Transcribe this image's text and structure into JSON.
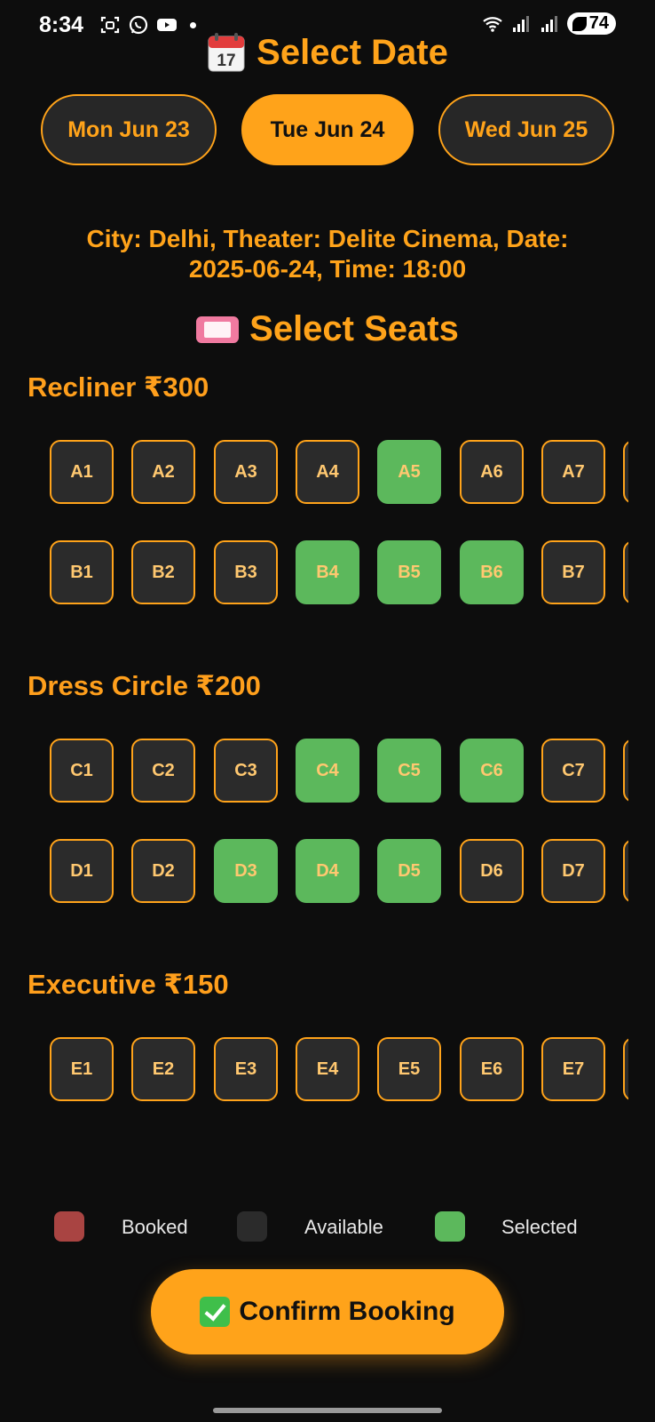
{
  "status_bar": {
    "time": "8:34",
    "battery": "74",
    "left_icons": [
      "scan-icon",
      "whatsapp-icon",
      "youtube-icon",
      "dot-icon"
    ],
    "right_icons": [
      "wifi-icon",
      "signal-icon",
      "signal-icon",
      "battery-icon"
    ]
  },
  "header": {
    "title": "Select Date",
    "icon": "calendar-icon"
  },
  "dates": [
    {
      "label": "Mon Jun 23",
      "selected": false
    },
    {
      "label": "Tue Jun 24",
      "selected": true
    },
    {
      "label": "Wed Jun 25",
      "selected": false
    }
  ],
  "info": {
    "line1": "City: Delhi, Theater: Delite Cinema, Date:",
    "line2": "2025-06-24, Time: 18:00"
  },
  "seats_header": {
    "title": "Select Seats",
    "icon": "ticket-icon"
  },
  "sections": [
    {
      "title": "Recliner ₹300",
      "rows": [
        {
          "seats": [
            {
              "label": "A1",
              "status": "available"
            },
            {
              "label": "A2",
              "status": "available"
            },
            {
              "label": "A3",
              "status": "available"
            },
            {
              "label": "A4",
              "status": "available"
            },
            {
              "label": "A5",
              "status": "selected"
            },
            {
              "label": "A6",
              "status": "available"
            },
            {
              "label": "A7",
              "status": "available"
            },
            {
              "label": "",
              "status": "available"
            }
          ]
        },
        {
          "seats": [
            {
              "label": "B1",
              "status": "available"
            },
            {
              "label": "B2",
              "status": "available"
            },
            {
              "label": "B3",
              "status": "available"
            },
            {
              "label": "B4",
              "status": "selected"
            },
            {
              "label": "B5",
              "status": "selected"
            },
            {
              "label": "B6",
              "status": "selected"
            },
            {
              "label": "B7",
              "status": "available"
            },
            {
              "label": "",
              "status": "available"
            }
          ]
        }
      ]
    },
    {
      "title": "Dress Circle ₹200",
      "rows": [
        {
          "seats": [
            {
              "label": "C1",
              "status": "available"
            },
            {
              "label": "C2",
              "status": "available"
            },
            {
              "label": "C3",
              "status": "available"
            },
            {
              "label": "C4",
              "status": "selected"
            },
            {
              "label": "C5",
              "status": "selected"
            },
            {
              "label": "C6",
              "status": "selected"
            },
            {
              "label": "C7",
              "status": "available"
            },
            {
              "label": "",
              "status": "available"
            }
          ]
        },
        {
          "seats": [
            {
              "label": "D1",
              "status": "available"
            },
            {
              "label": "D2",
              "status": "available"
            },
            {
              "label": "D3",
              "status": "selected"
            },
            {
              "label": "D4",
              "status": "selected"
            },
            {
              "label": "D5",
              "status": "selected"
            },
            {
              "label": "D6",
              "status": "available"
            },
            {
              "label": "D7",
              "status": "available"
            },
            {
              "label": "",
              "status": "available"
            }
          ]
        }
      ]
    },
    {
      "title": "Executive ₹150",
      "rows": [
        {
          "seats": [
            {
              "label": "E1",
              "status": "available"
            },
            {
              "label": "E2",
              "status": "available"
            },
            {
              "label": "E3",
              "status": "available"
            },
            {
              "label": "E4",
              "status": "available"
            },
            {
              "label": "E5",
              "status": "available"
            },
            {
              "label": "E6",
              "status": "available"
            },
            {
              "label": "E7",
              "status": "available"
            },
            {
              "label": "",
              "status": "available"
            }
          ]
        }
      ]
    }
  ],
  "legend": [
    {
      "label": "Booked",
      "color": "#a94442"
    },
    {
      "label": "Available",
      "color": "#2b2b2b"
    },
    {
      "label": "Selected",
      "color": "#5cb85c"
    }
  ],
  "confirm": {
    "label": "Confirm Booking",
    "icon": "check-icon"
  },
  "colors": {
    "accent": "#ffa31a",
    "background": "#0d0d0d",
    "selected": "#5cb85c",
    "booked": "#a94442",
    "available": "#2b2b2b"
  }
}
